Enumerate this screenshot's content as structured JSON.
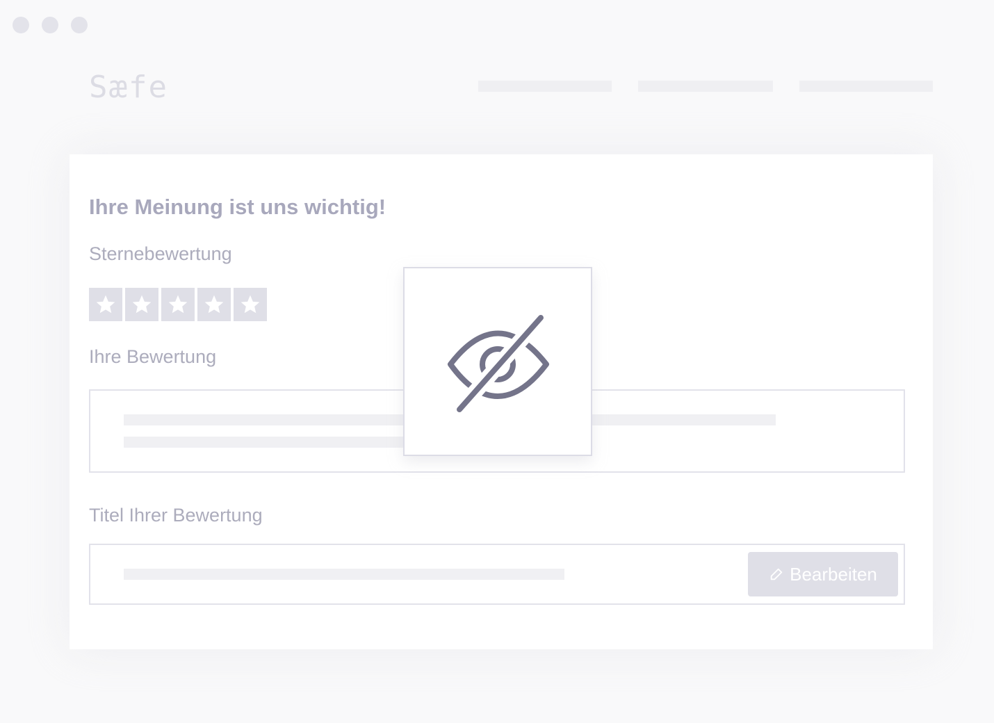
{
  "window": {
    "controls": [
      "close",
      "minimize",
      "maximize"
    ]
  },
  "header": {
    "logo_text": "Sæfe",
    "nav_items": [
      "",
      "",
      ""
    ]
  },
  "form": {
    "title": "Ihre Meinung ist uns wichtig!",
    "rating_label": "Sternebewertung",
    "rating": {
      "value": 0,
      "max": 5
    },
    "review_label": "Ihre Bewertung",
    "review_title_label": "Titel Ihrer Bewertung",
    "edit_button_label": "Bearbeiten"
  },
  "overlay": {
    "icon": "eye-slash-icon"
  },
  "colors": {
    "accent_muted": "#a8a8bc",
    "star_box": "#dfdfe7",
    "icon": "#74748a"
  }
}
